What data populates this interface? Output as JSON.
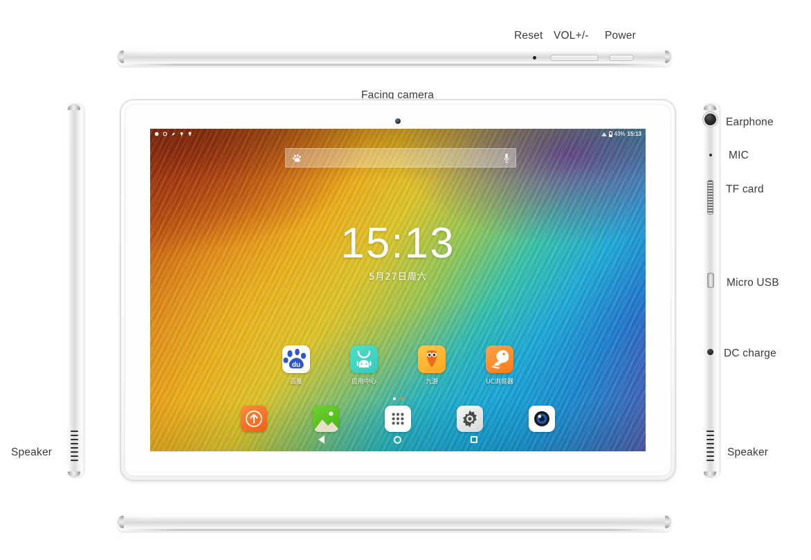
{
  "page": {
    "title": "Tablet hardware callout diagram",
    "background": "#ffffff"
  },
  "callouts": {
    "reset": "Reset",
    "volume": "VOL+/-",
    "power": "Power",
    "facing_camera": "Facing camera",
    "earphone": "Earphone",
    "mic": "MIC",
    "tf_card": "TF card",
    "micro_usb": "Micro USB",
    "dc_charge": "DC charge",
    "speaker_left": "Speaker",
    "speaker_right": "Speaker"
  },
  "device": {
    "body_color": "#f2f2f2",
    "bezel_color": "#fdfdfd",
    "frame_accent": "#c9c9c9"
  },
  "screen": {
    "wallpaper": {
      "description": "feather gradient",
      "colors": [
        "#8d3412",
        "#e08516",
        "#e9a91a",
        "#d9c22a",
        "#8fc457",
        "#37bfa8",
        "#1fa8d4",
        "#2276c9",
        "#6b3f96"
      ]
    },
    "statusbar": {
      "battery_percent": "43%",
      "time": "15:13",
      "left_icons": [
        "notification-dot-icon",
        "circle-icon",
        "weather-icon",
        "alarm-icon",
        "bulb-icon"
      ],
      "right_icons": [
        "wifi-icon",
        "battery-icon"
      ]
    },
    "search_widget": {
      "left_icon": "baidu-paw-icon",
      "right_icon": "microphone-icon",
      "placeholder": ""
    },
    "clock": {
      "time": "15:13",
      "date": "5月27日周六"
    },
    "apps": [
      {
        "label": "百度",
        "icon": "baidu-icon",
        "bg": "#ffffff",
        "accent": "#2d56c8"
      },
      {
        "label": "应用中心",
        "icon": "app-center-icon",
        "bg": "#3fd6bd",
        "accent": "#ffffff"
      },
      {
        "label": "九游",
        "icon": "jiuyou-icon",
        "bg": "#ffb02e",
        "accent": "#e8620d"
      },
      {
        "label": "UC浏览器",
        "icon": "uc-browser-icon",
        "bg": "#ff8f2e",
        "accent": "#ffffff"
      }
    ],
    "page_dots": {
      "count": 2,
      "active_index": 1,
      "active_color": "#ff7a2e"
    },
    "dock": [
      {
        "icon": "upload-arrow-icon",
        "bg": "#f4751f"
      },
      {
        "icon": "gallery-icon",
        "bg": "#57c122"
      },
      {
        "icon": "app-drawer-icon",
        "bg": "#ffffff"
      },
      {
        "icon": "settings-gear-icon",
        "bg": "#e9e9e9"
      },
      {
        "icon": "camera-icon",
        "bg": "#ffffff"
      }
    ],
    "navbar": [
      {
        "icon": "nav-back-icon"
      },
      {
        "icon": "nav-home-icon"
      },
      {
        "icon": "nav-recents-icon"
      }
    ]
  }
}
